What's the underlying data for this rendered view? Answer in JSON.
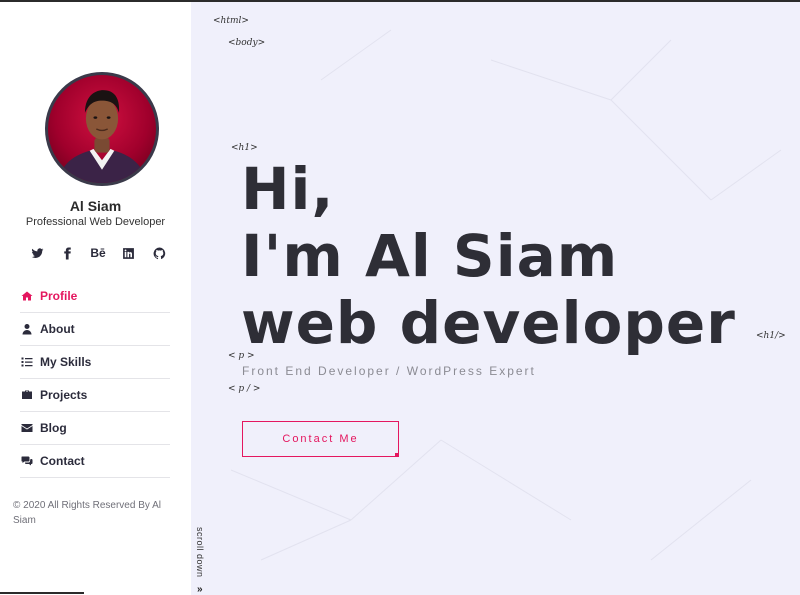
{
  "profile": {
    "name": "Al Siam",
    "role": "Professional Web Developer"
  },
  "socials": [
    {
      "icon": "twitter-icon",
      "label": ""
    },
    {
      "icon": "facebook-icon",
      "label": ""
    },
    {
      "icon": "behance-icon",
      "label": "Bē"
    },
    {
      "icon": "linkedin-icon",
      "label": ""
    },
    {
      "icon": "github-icon",
      "label": ""
    }
  ],
  "nav": {
    "items": [
      {
        "label": "Profile",
        "icon": "home-icon",
        "active": true
      },
      {
        "label": "About",
        "icon": "user-icon",
        "active": false
      },
      {
        "label": "My Skills",
        "icon": "list-icon",
        "active": false
      },
      {
        "label": "Projects",
        "icon": "briefcase-icon",
        "active": false
      },
      {
        "label": "Blog",
        "icon": "envelope-icon",
        "active": false
      },
      {
        "label": "Contact",
        "icon": "comments-icon",
        "active": false
      }
    ]
  },
  "footer": {
    "text": "© 2020 All Rights Reserved By Al Siam"
  },
  "hero": {
    "tag_html": "<html>",
    "tag_body": "<body>",
    "tag_h1_open": "<h1>",
    "tag_h1_close": "<h1/>",
    "tag_p_open": "< p >",
    "tag_p_close": "< p / >",
    "line1": "Hi,",
    "line2": "I'm Al Siam",
    "line3": "web developer",
    "subtitle": "Front End Developer / WordPress Expert",
    "cta_label": "Contact Me",
    "scroll_label": "scroll down",
    "scroll_chevron": "»"
  },
  "colors": {
    "accent": "#e4175f",
    "main_bg": "#f0f0fb",
    "text_dark": "#2e2e36"
  }
}
